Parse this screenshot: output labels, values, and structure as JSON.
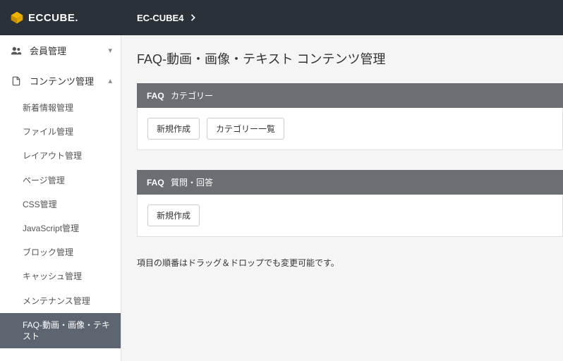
{
  "topbar": {
    "logo_text": "ECCUBE.",
    "breadcrumb": "EC-CUBE4"
  },
  "sidebar": {
    "group_partial": {
      "label": ""
    },
    "group_member": {
      "label": "会員管理"
    },
    "group_content": {
      "label": "コンテンツ管理",
      "items": [
        {
          "label": "新着情報管理"
        },
        {
          "label": "ファイル管理"
        },
        {
          "label": "レイアウト管理"
        },
        {
          "label": "ページ管理"
        },
        {
          "label": "CSS管理"
        },
        {
          "label": "JavaScript管理"
        },
        {
          "label": "ブロック管理"
        },
        {
          "label": "キャッシュ管理"
        },
        {
          "label": "メンテナンス管理"
        },
        {
          "label": "FAQ-動画・画像・テキスト"
        }
      ]
    }
  },
  "main": {
    "page_title": "FAQ-動画・画像・テキスト コンテンツ管理",
    "section1": {
      "tag": "FAQ",
      "title": "カテゴリー",
      "btn_new": "新規作成",
      "btn_list": "カテゴリー一覧"
    },
    "section2": {
      "tag": "FAQ",
      "title": "質問・回答",
      "btn_new": "新規作成"
    },
    "info": "項目の順番はドラッグ＆ドロップでも変更可能です。"
  }
}
